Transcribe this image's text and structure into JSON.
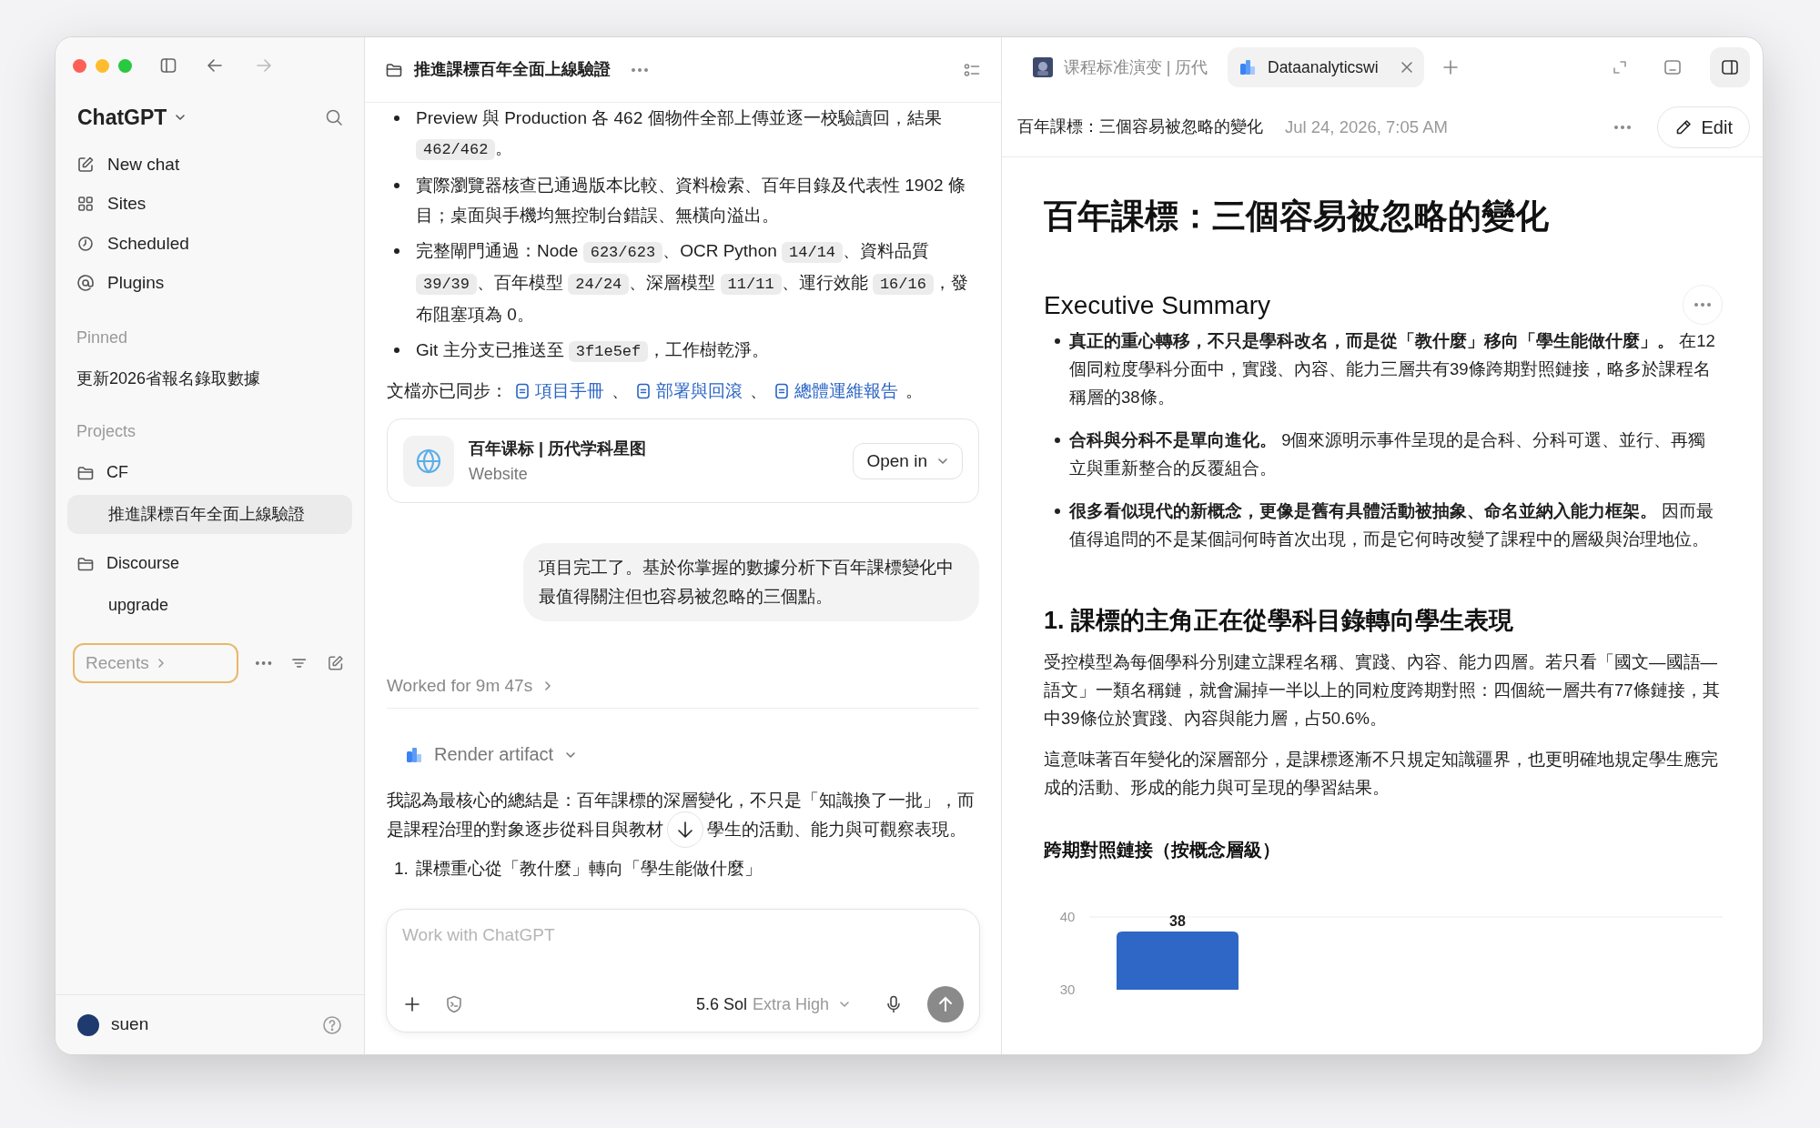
{
  "sidebar": {
    "app_title": "ChatGPT",
    "nav": [
      {
        "label": "New chat"
      },
      {
        "label": "Sites"
      },
      {
        "label": "Scheduled"
      },
      {
        "label": "Plugins"
      }
    ],
    "pinned_heading": "Pinned",
    "pinned": [
      {
        "label": "更新2026省報名錄取數據",
        "selected": false
      }
    ],
    "projects_heading": "Projects",
    "projects": [
      {
        "label": "CF",
        "children": [
          {
            "label": "推進課標百年全面上線驗證",
            "selected": true
          }
        ]
      },
      {
        "label": "Discourse",
        "children": [
          {
            "label": "upgrade",
            "selected": false
          }
        ]
      }
    ],
    "recents": {
      "label": "Recents",
      "focused": true
    },
    "user": {
      "name": "suen"
    }
  },
  "chat": {
    "title": "推進課標百年全面上線驗證",
    "bullets": [
      [
        {
          "kind": "text",
          "text": "Preview 與 Production 各 462 個物件全部上傳並逐一校驗讀回，結果 "
        },
        {
          "kind": "code",
          "text": "462/462"
        },
        {
          "kind": "text",
          "text": "。"
        }
      ],
      [
        {
          "kind": "text",
          "text": "實際瀏覽器核查已通過版本比較、資料檢索、百年目錄及代表性 1902 條目；桌面與手機均無控制台錯誤、無橫向溢出。"
        }
      ],
      [
        {
          "kind": "text",
          "text": "完整閘門通過：Node "
        },
        {
          "kind": "code",
          "text": "623/623"
        },
        {
          "kind": "text",
          "text": "、OCR Python "
        },
        {
          "kind": "code",
          "text": "14/14"
        },
        {
          "kind": "text",
          "text": "、資料品質 "
        },
        {
          "kind": "code",
          "text": "39/39"
        },
        {
          "kind": "text",
          "text": "、百年模型 "
        },
        {
          "kind": "code",
          "text": "24/24"
        },
        {
          "kind": "text",
          "text": "、深層模型 "
        },
        {
          "kind": "code",
          "text": "11/11"
        },
        {
          "kind": "text",
          "text": "、運行效能 "
        },
        {
          "kind": "code",
          "text": "16/16"
        },
        {
          "kind": "text",
          "text": "，發布阻塞項為 0。"
        }
      ],
      [
        {
          "kind": "text",
          "text": "Git 主分支已推送至 "
        },
        {
          "kind": "code",
          "text": "3f1e5ef"
        },
        {
          "kind": "text",
          "text": "，工作樹乾淨。"
        }
      ]
    ],
    "docs_line": [
      {
        "kind": "text",
        "text": "文檔亦已同步："
      },
      {
        "kind": "link",
        "text": "項目手冊"
      },
      {
        "kind": "text",
        "text": "、"
      },
      {
        "kind": "link",
        "text": "部署與回滾"
      },
      {
        "kind": "text",
        "text": "、"
      },
      {
        "kind": "link",
        "text": "總體運維報告"
      },
      {
        "kind": "text",
        "text": "。"
      }
    ],
    "card": {
      "title": "百年课标 | 历代学科星图",
      "subtitle": "Website",
      "button": "Open in"
    },
    "user_message": "項目完工了。基於你掌握的數據分析下百年課標變化中最值得關注但也容易被忽略的三個點。",
    "worked": "Worked for 9m 47s",
    "artifact": "Render artifact",
    "answer": [
      "我認為最核心的總結是：百年課標的深層變化，不只是「知識換了一批」，而",
      "是課程治理的對象逐步從科目與教材",
      "學生的活動、能力與可觀察表現。"
    ],
    "numbered": [
      {
        "number": "1.",
        "text": "課標重心從「教什麼」轉向「學生能做什麼」"
      }
    ],
    "composer": {
      "placeholder": "Work with ChatGPT",
      "model": "5.6 Sol",
      "effort": "Extra High"
    }
  },
  "preview": {
    "tabs": [
      {
        "label": "课程标准演变 | 历代",
        "selected": false
      },
      {
        "label": "Dataanalyticswi",
        "selected": true
      }
    ],
    "doc_title": "百年課標：三個容易被忽略的變化",
    "date": "Jul 24, 2026, 7:05 AM",
    "edit": "Edit",
    "heading": "百年課標：三個容易被忽略的變化",
    "summary_heading": "Executive Summary",
    "summary": [
      "**真正的重心轉移，不只是學科改名，而是從「教什麼」移向「學生能做什麼」。** 在12個同粒度學科分面中，實踐、內容、能力三層共有39條跨期對照鏈接，略多於課程名稱層的38條。",
      "**合科與分科不是單向進化。** 9個來源明示事件呈現的是合科、分科可選、並行、再獨立與重新整合的反覆組合。",
      "**很多看似現代的新概念，更像是舊有具體活動被抽象、命名並納入能力框架。** 因而最值得追問的不是某個詞何時首次出現，而是它何時改變了課程中的層級與治理地位。"
    ],
    "section_heading": "1. 課標的主角正在從學科目錄轉向學生表現",
    "paragraphs": [
      "受控模型為每個學科分別建立課程名稱、實踐、內容、能力四層。若只看「國文—國語—語文」一類名稱鏈，就會漏掉一半以上的同粒度跨期對照：四個統一層共有77條鏈接，其中39條位於實踐、內容與能力層，占50.6%。",
      "這意味著百年變化的深層部分，是課標逐漸不只規定知識疆界，也更明確地規定學生應完成的活動、形成的能力與可呈現的學習結果。"
    ],
    "chart_data": {
      "type": "bar",
      "title": "跨期對照鏈接（按概念層級）",
      "values": [
        38
      ],
      "ylim": [
        30,
        40
      ],
      "yticks": [
        30,
        40
      ],
      "data_labels": true
    }
  }
}
